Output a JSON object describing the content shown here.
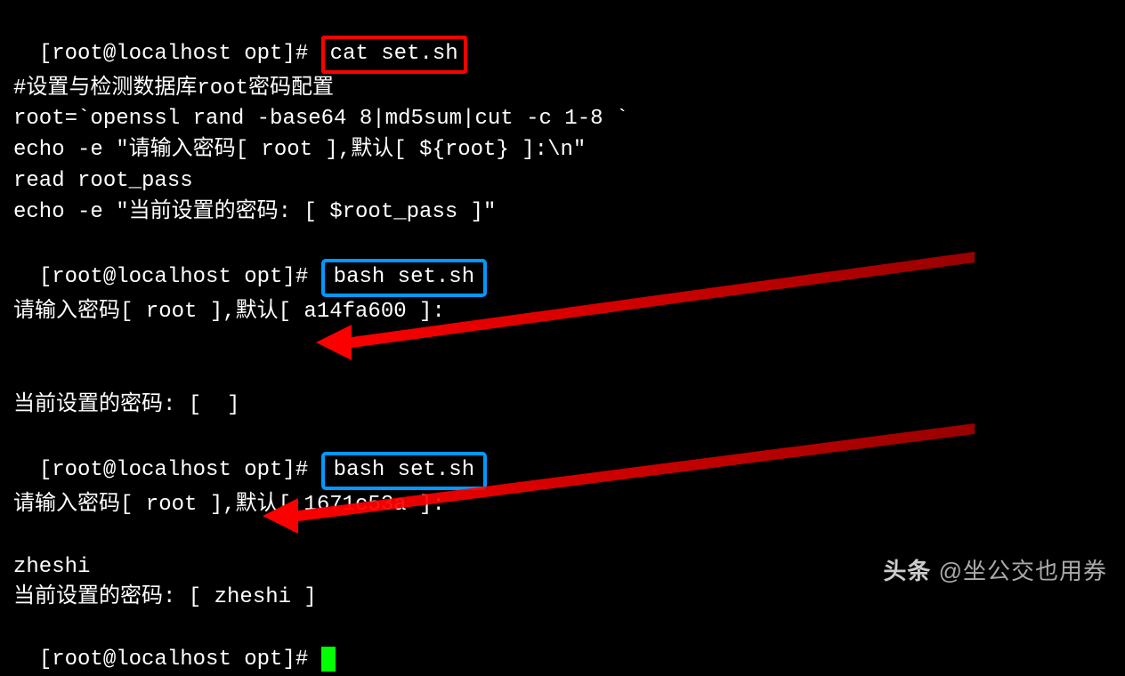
{
  "terminal": {
    "prompt": "[root@localhost opt]# ",
    "cmd1": "cat set.sh",
    "script": {
      "comment": "#设置与检测数据库root密码配置",
      "l1": "root=`openssl rand -base64 8|md5sum|cut -c 1-8 `",
      "l2": "echo -e \"请输入密码[ root ],默认[ ${root} ]:\\n\"",
      "l3": "read root_pass",
      "l4": "echo -e \"当前设置的密码: [ $root_pass ]\""
    },
    "cmd2": "bash set.sh",
    "run1": {
      "prompt_line": "请输入密码[ root ],默认[ a14fa600 ]:",
      "result_line": "当前设置的密码: [  ]"
    },
    "cmd3": "bash set.sh",
    "run2": {
      "prompt_line": "请输入密码[ root ],默认[ 1671c53a ]:",
      "input": "zheshi",
      "result_line": "当前设置的密码: [ zheshi ]"
    }
  },
  "watermark": {
    "brand": "头条",
    "handle": "@坐公交也用券"
  }
}
